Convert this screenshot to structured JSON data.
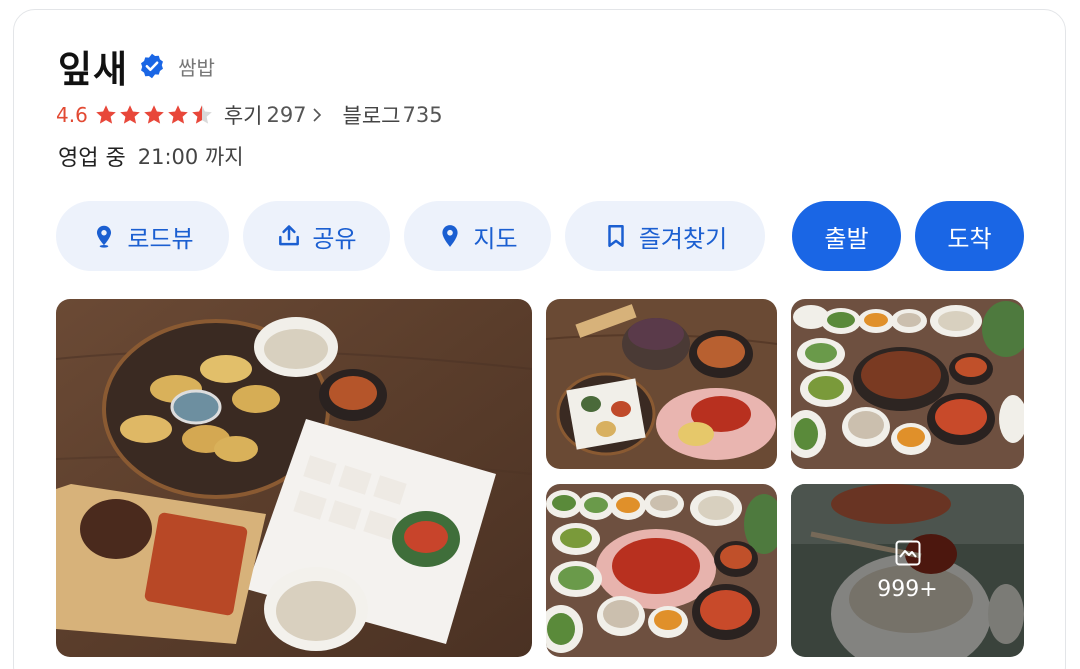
{
  "place": {
    "name": "잎새",
    "category": "쌈밥",
    "verified": true
  },
  "rating": {
    "score": "4.6",
    "stars_filled": 4.5,
    "stars_total": 5,
    "star_color": "#e8473a"
  },
  "reviews": {
    "label": "후기",
    "count": "297"
  },
  "blog": {
    "label": "블로그",
    "count": "735"
  },
  "hours": {
    "status": "영업 중",
    "until": "21:00 까지"
  },
  "actions": {
    "roadview": {
      "label": "로드뷰",
      "icon": "pin-person-icon"
    },
    "share": {
      "label": "공유",
      "icon": "share-icon"
    },
    "map": {
      "label": "지도",
      "icon": "map-pin-icon"
    },
    "bookmark": {
      "label": "즐겨찾기",
      "icon": "bookmark-icon"
    },
    "depart": {
      "label": "출발"
    },
    "arrive": {
      "label": "도착"
    }
  },
  "photos": {
    "more_count": "999+",
    "more_icon": "gallery-icon"
  },
  "colors": {
    "accent": "#1a66e5",
    "accent_light_bg": "#edf2fb",
    "accent_text": "#1b5fd1",
    "rating_text": "#e24a33"
  }
}
